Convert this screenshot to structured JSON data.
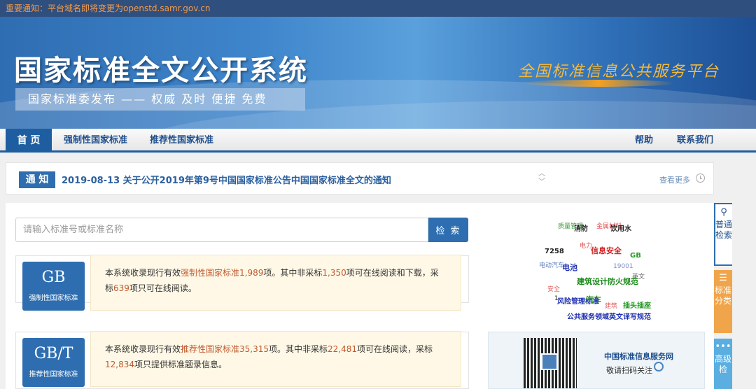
{
  "top_notice": "重要通知：平台域名即将变更为openstd.samr.gov.cn",
  "header": {
    "title": "国家标准全文公开系统",
    "slogan": "国家标准委发布 —— 权威 及时 便捷 免费",
    "platform": "全国标准信息公共服务平台"
  },
  "nav": {
    "home": "首 页",
    "items": [
      "强制性国家标准",
      "推荐性国家标准"
    ],
    "right": [
      "帮助",
      "联系我们"
    ]
  },
  "notice": {
    "tag": "通 知",
    "text": "2019-08-13 关于公开2019年第9号中国国家标准公告中国国家标准全文的通知",
    "more": "查看更多"
  },
  "search": {
    "placeholder": "请输入标准号或标准名称",
    "button": "检 索"
  },
  "cards": {
    "gb": {
      "code": "GB",
      "sub": "强制性国家标准",
      "t1": "本系统收录现行有效",
      "link": "强制性国家标准",
      "n1": "1,989",
      "t2": "项。其中非采标",
      "n2": "1,350",
      "t3": "项可在线阅读和下载，采标",
      "n3": "639",
      "t4": "项只可在线阅读。"
    },
    "gbt": {
      "code": "GB/T",
      "sub": "推荐性国家标准",
      "t1": "本系统收录现行有效",
      "link": "推荐性国家标准",
      "n1": "35,315",
      "t2": "项。其中非采标",
      "n2": "22,481",
      "t3": "项可在线阅读，采标",
      "n3": "12,834",
      "t4": "项只提供标准题录信息。"
    }
  },
  "tag_cloud": [
    {
      "text": "质量管理",
      "color": "#3a9a3a",
      "size": 9
    },
    {
      "text": "消防",
      "color": "#222222",
      "size": 10
    },
    {
      "text": "金属材料",
      "color": "#e05050",
      "size": 9
    },
    {
      "text": "饮用水",
      "color": "#222222",
      "size": 10
    },
    {
      "text": "电力",
      "color": "#e05050",
      "size": 9
    },
    {
      "text": "7258",
      "color": "#222222",
      "size": 10
    },
    {
      "text": "信息安全",
      "color": "#d02020",
      "size": 11
    },
    {
      "text": "GB",
      "color": "#2a9a2a",
      "size": 10
    },
    {
      "text": "电动汽车",
      "color": "#6080c0",
      "size": 9
    },
    {
      "text": "电池",
      "color": "#2030b0",
      "size": 11
    },
    {
      "text": "19001",
      "color": "#8090c0",
      "size": 9
    },
    {
      "text": "英文",
      "color": "#666666",
      "size": 9
    },
    {
      "text": "建筑设计防火规范",
      "color": "#1a8a1a",
      "size": 11
    },
    {
      "text": "安全",
      "color": "#e06060",
      "size": 9
    },
    {
      "text": "1",
      "color": "#222222",
      "size": 9
    },
    {
      "text": "风险管理标准",
      "color": "#2030b0",
      "size": 10
    },
    {
      "text": "汽车",
      "color": "#1a8a1a",
      "size": 11
    },
    {
      "text": "建筑",
      "color": "#e06060",
      "size": 9
    },
    {
      "text": "插头插座",
      "color": "#2a9a2a",
      "size": 10
    },
    {
      "text": "公共服务领域英文译写规范",
      "color": "#2030b0",
      "size": 10
    }
  ],
  "qr": {
    "title": "中国标准信息服务网",
    "sub": "敬请扫码关注"
  },
  "side_tabs": {
    "search": "普通检索",
    "category": "标准分类",
    "advanced": "高级检"
  }
}
